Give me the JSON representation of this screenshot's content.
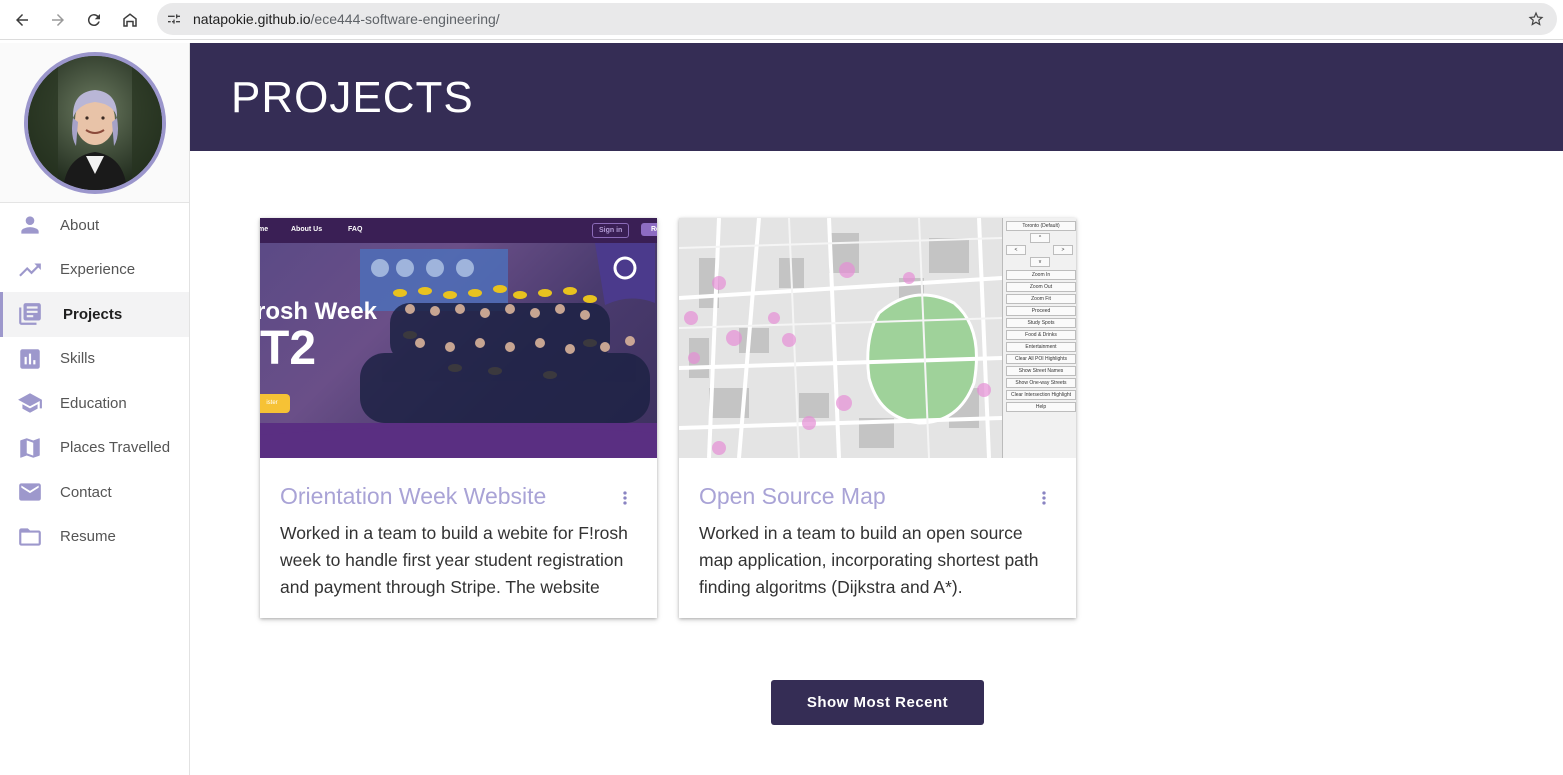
{
  "browser": {
    "url_host": "natapokie.github.io",
    "url_path": "/ece444-software-engineering/"
  },
  "sidebar": {
    "items": [
      {
        "label": "About",
        "icon": "person-icon"
      },
      {
        "label": "Experience",
        "icon": "trending-up-icon"
      },
      {
        "label": "Projects",
        "icon": "library-books-icon",
        "active": true
      },
      {
        "label": "Skills",
        "icon": "bar-chart-icon"
      },
      {
        "label": "Education",
        "icon": "school-icon"
      },
      {
        "label": "Places Travelled",
        "icon": "map-icon"
      },
      {
        "label": "Contact",
        "icon": "mail-icon"
      },
      {
        "label": "Resume",
        "icon": "folder-icon"
      }
    ]
  },
  "header": {
    "title": "PROJECTS"
  },
  "cards": [
    {
      "title": "Orientation Week Website",
      "description": "Worked in a team to build a webite for F!rosh week to handle first year student registration and payment through Stripe. The website",
      "image": {
        "nav": [
          "me",
          "About Us",
          "FAQ",
          "Sign in",
          "Re"
        ],
        "headline1": "rosh Week",
        "headline2": "T2",
        "cta": "ister"
      }
    },
    {
      "title": "Open Source Map",
      "description": "Worked in a team to build an open source map application, incorporating shortest path finding algoritms (Dijkstra and A*).",
      "image": {
        "panel_buttons": [
          "Toronto (Default)",
          "Zoom In",
          "Zoom Out",
          "Zoom Fit",
          "Proceed",
          "Study Spots",
          "Food & Drinks",
          "Entertainment",
          "Clear All POI Highlights",
          "Show Street Names",
          "Show One-way Streets",
          "Clear Intersection Highlight",
          "Help"
        ]
      }
    }
  ],
  "actions": {
    "show_recent_label": "Show Most Recent"
  },
  "colors": {
    "header_bg": "#352d55",
    "accent": "#9d98cc",
    "card_title": "#a9a3d6"
  }
}
